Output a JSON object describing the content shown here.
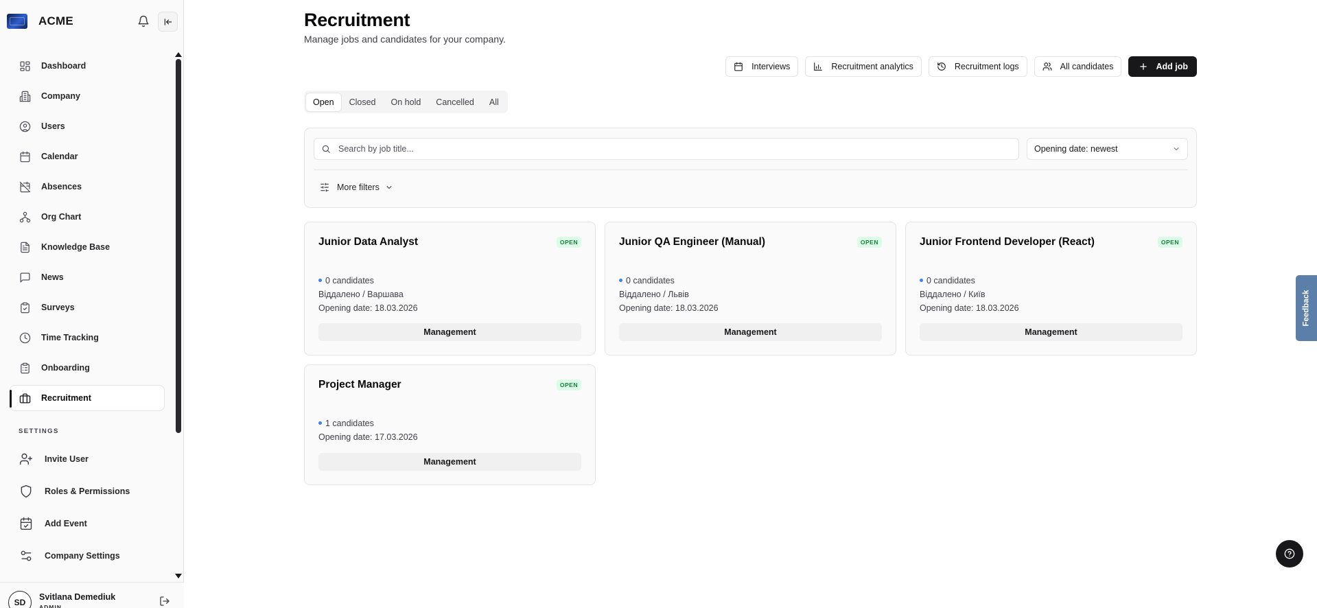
{
  "brand": {
    "name": "ACME"
  },
  "sidebar": {
    "items": [
      {
        "label": "Dashboard",
        "icon": "dashboard-icon"
      },
      {
        "label": "Company",
        "icon": "building-icon"
      },
      {
        "label": "Users",
        "icon": "user-circle-icon"
      },
      {
        "label": "Calendar",
        "icon": "calendar-icon"
      },
      {
        "label": "Absences",
        "icon": "calendar-off-icon"
      },
      {
        "label": "Org Chart",
        "icon": "org-chart-icon"
      },
      {
        "label": "Knowledge Base",
        "icon": "document-icon"
      },
      {
        "label": "News",
        "icon": "chat-bubble-icon"
      },
      {
        "label": "Surveys",
        "icon": "clipboard-check-icon"
      },
      {
        "label": "Time Tracking",
        "icon": "clock-icon"
      },
      {
        "label": "Onboarding",
        "icon": "clipboard-list-icon"
      },
      {
        "label": "Recruitment",
        "icon": "briefcase-icon",
        "active": true
      }
    ],
    "settings_heading": "SETTINGS",
    "settings_items": [
      {
        "label": "Invite User",
        "icon": "user-plus-icon"
      },
      {
        "label": "Roles & Permissions",
        "icon": "shield-icon"
      },
      {
        "label": "Add Event",
        "icon": "calendar-check-icon"
      },
      {
        "label": "Company Settings",
        "icon": "sliders-icon"
      }
    ]
  },
  "user": {
    "initials": "SD",
    "name": "Svitlana Demediuk",
    "role": "ADMIN"
  },
  "page": {
    "title": "Recruitment",
    "subtitle": "Manage jobs and candidates for your company."
  },
  "actions": {
    "interviews": "Interviews",
    "analytics": "Recruitment analytics",
    "logs": "Recruitment logs",
    "candidates": "All candidates",
    "add_job": "Add job"
  },
  "tabs": [
    "Open",
    "Closed",
    "On hold",
    "Cancelled",
    "All"
  ],
  "active_tab": "Open",
  "filters": {
    "search_placeholder": "Search by job title...",
    "search_value": "",
    "sort_value": "Opening date: newest",
    "more_filters": "More filters"
  },
  "jobs": [
    {
      "title": "Junior Data Analyst",
      "status": "OPEN",
      "candidates": "0 candidates",
      "location": "Віддалено / Варшава",
      "opening": "Opening date: 18.03.2026",
      "department": "Management"
    },
    {
      "title": "Junior QA Engineer (Manual)",
      "status": "OPEN",
      "candidates": "0 candidates",
      "location": "Віддалено / Львів",
      "opening": "Opening date: 18.03.2026",
      "department": "Management"
    },
    {
      "title": "Junior Frontend Developer (React)",
      "status": "OPEN",
      "candidates": "0 candidates",
      "location": "Віддалено / Київ",
      "opening": "Opening date: 18.03.2026",
      "department": "Management"
    },
    {
      "title": "Project Manager",
      "status": "OPEN",
      "candidates": "1 candidates",
      "opening": "Opening date: 17.03.2026",
      "department": "Management"
    }
  ],
  "feedback_label": "Feedback",
  "colors": {
    "primary": "#18181b",
    "badge_bg": "#dcfce7",
    "badge_text": "#15803d",
    "candidate_dot": "#3b82f6",
    "feedback_tab": "#5b7fa8"
  }
}
